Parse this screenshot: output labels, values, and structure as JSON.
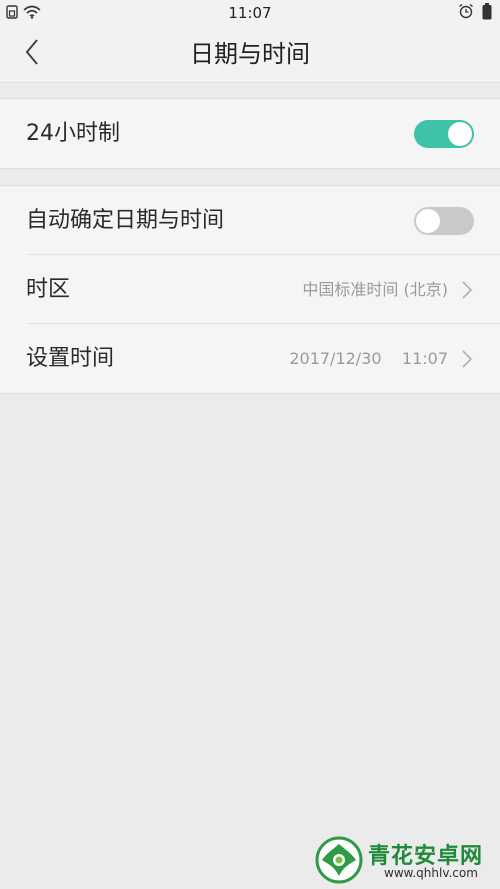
{
  "status_bar": {
    "time": "11:07",
    "left_icons": [
      "sim-card-icon",
      "wifi-icon"
    ],
    "right_icons": [
      "alarm-clock-icon",
      "battery-icon"
    ]
  },
  "nav": {
    "title": "日期与时间",
    "back_icon": "chevron-left-icon"
  },
  "sections": [
    {
      "rows": [
        {
          "label": "24小时制",
          "control": "toggle",
          "enabled": true
        }
      ]
    },
    {
      "rows": [
        {
          "label": "自动确定日期与时间",
          "control": "toggle",
          "enabled": false
        },
        {
          "label": "时区",
          "value": "中国标准时间 (北京)",
          "control": "chevron"
        },
        {
          "label": "设置时间",
          "value": "2017/12/30    11:07",
          "control": "chevron"
        }
      ]
    }
  ],
  "watermark": {
    "name": "青花安卓网",
    "url": "www.qhhlv.com"
  },
  "colors": {
    "accent_toggle_on": "#3ec2a8",
    "toggle_off": "#c9c9c9",
    "background": "#ebebeb",
    "row_background": "#f5f5f5",
    "watermark_green": "#1f8a3a"
  }
}
